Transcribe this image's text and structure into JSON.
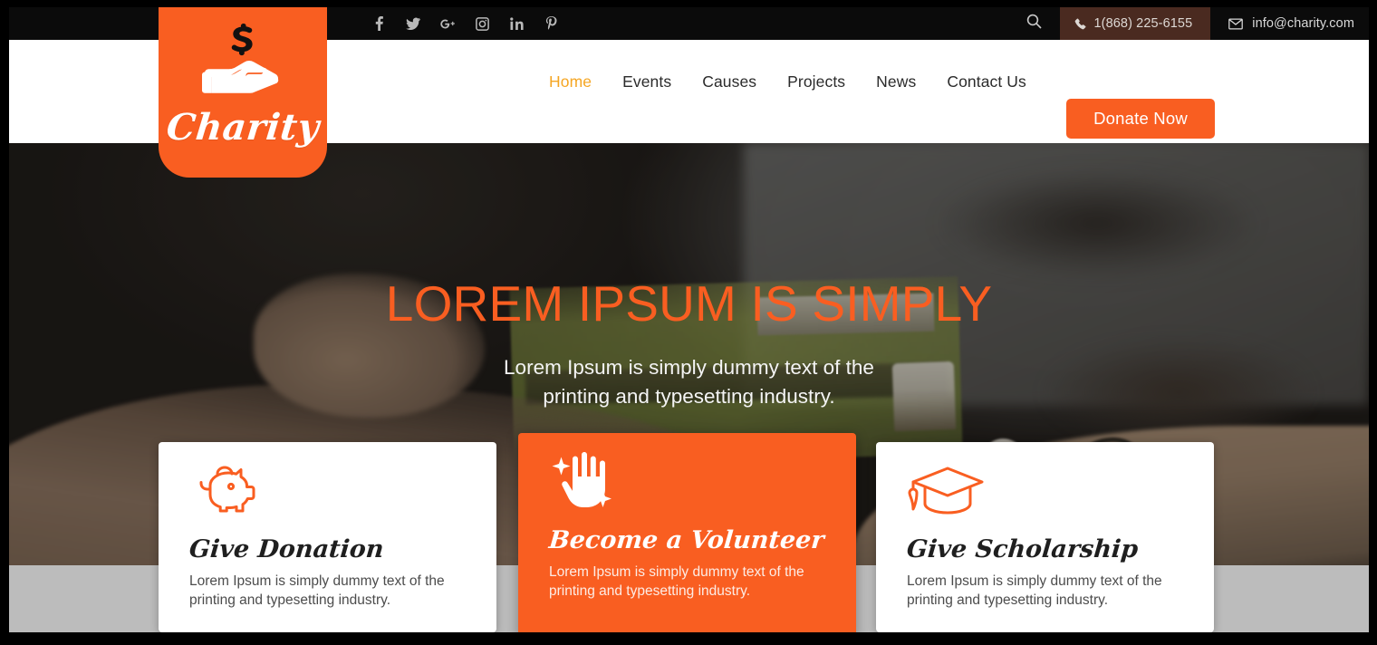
{
  "topbar": {
    "social": [
      {
        "name": "facebook-icon",
        "label": "Facebook"
      },
      {
        "name": "twitter-icon",
        "label": "Twitter"
      },
      {
        "name": "google-plus-icon",
        "label": "Google Plus"
      },
      {
        "name": "instagram-icon",
        "label": "Instagram"
      },
      {
        "name": "linkedin-icon",
        "label": "LinkedIn"
      },
      {
        "name": "pinterest-icon",
        "label": "Pinterest"
      }
    ],
    "search_label": "Search",
    "phone": "1(868) 225-6155",
    "email": "info@charity.com",
    "phone_bg": "#4a2a20",
    "bg": "#0b0b0b"
  },
  "logo": {
    "word": "Charity",
    "bg": "#f95e21",
    "mark": "hand-with-dollar-icon"
  },
  "nav": {
    "items": [
      {
        "label": "Home",
        "active": true
      },
      {
        "label": "Events",
        "active": false
      },
      {
        "label": "Causes",
        "active": false
      },
      {
        "label": "Projects",
        "active": false
      },
      {
        "label": "News",
        "active": false
      },
      {
        "label": "Contact Us",
        "active": false
      }
    ],
    "active_color": "#f5a623",
    "donate_label": "Donate Now",
    "donate_color": "#f95e21"
  },
  "hero": {
    "title": "LOREM IPSUM IS SIMPLY",
    "title_color": "#f95e21",
    "subtitle_line1": "Lorem Ipsum is simply dummy text of the",
    "subtitle_line2": "printing and typesetting industry."
  },
  "cards": [
    {
      "icon": "piggy-bank-icon",
      "title": "Give Donation",
      "desc_line1": "Lorem Ipsum is simply dummy text of the",
      "desc_line2": "printing and typesetting industry.",
      "highlight": false
    },
    {
      "icon": "helping-hand-sparkle-icon",
      "title": "Become a Volunteer",
      "desc_line1": "Lorem Ipsum is simply dummy text of the",
      "desc_line2": "printing and typesetting industry.",
      "highlight": true
    },
    {
      "icon": "graduation-cap-icon",
      "title": "Give Scholarship",
      "desc_line1": "Lorem Ipsum is simply dummy text of the",
      "desc_line2": "printing and typesetting industry.",
      "highlight": false
    }
  ],
  "theme": {
    "accent": "#f95e21",
    "bottom_band": "#bcbcbc"
  }
}
